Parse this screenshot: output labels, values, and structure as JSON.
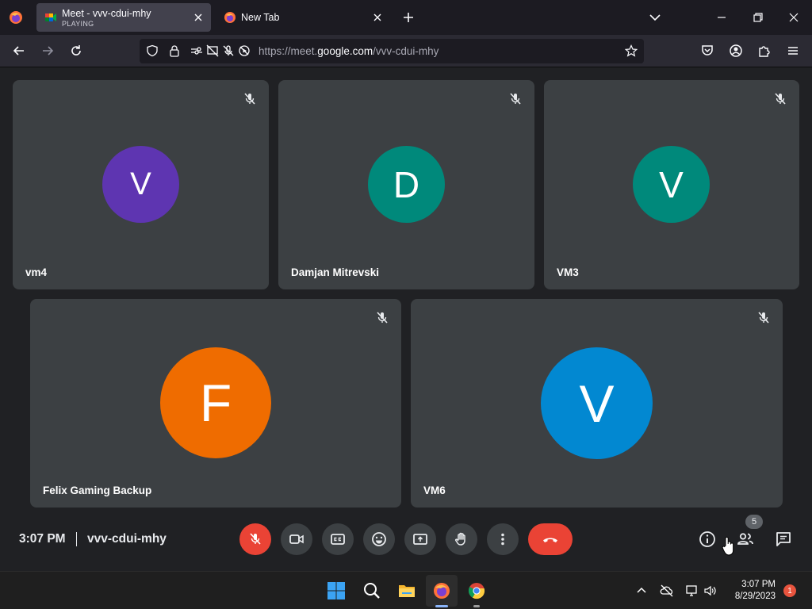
{
  "browser": {
    "tabs": [
      {
        "title": "Meet - vvv-cdui-mhy",
        "subtitle": "PLAYING"
      },
      {
        "title": "New Tab"
      }
    ],
    "url": {
      "scheme": "https://meet.",
      "domain": "google.com",
      "path": "/vvv-cdui-mhy"
    }
  },
  "meet": {
    "participants": [
      {
        "name": "vm4",
        "initial": "V",
        "color": "#5e35b1"
      },
      {
        "name": "Damjan Mitrevski",
        "initial": "D",
        "color": "#00897b"
      },
      {
        "name": "VM3",
        "initial": "V",
        "color": "#00897b"
      },
      {
        "name": "Felix Gaming Backup",
        "initial": "F",
        "color": "#ef6c00"
      },
      {
        "name": "VM6",
        "initial": "V",
        "color": "#0288d1"
      }
    ],
    "time": "3:07 PM",
    "meeting_code": "vvv-cdui-mhy",
    "participant_count": "5"
  },
  "taskbar": {
    "time": "3:07 PM",
    "date": "8/29/2023",
    "notifications": "1"
  }
}
